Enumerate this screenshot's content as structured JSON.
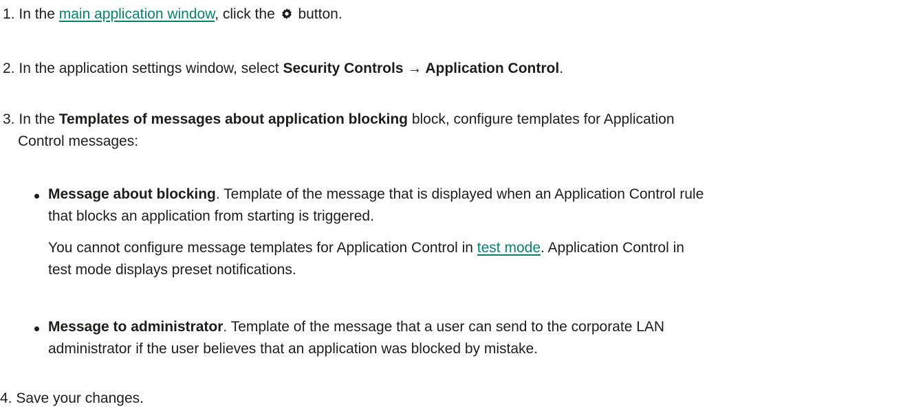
{
  "steps": [
    {
      "number": "1.",
      "text_before": "In the",
      "link": "main application window",
      "text_middle": ", click the",
      "icon": "gear-icon",
      "text_after": "button."
    },
    {
      "number": "2.",
      "text_before": "In the application settings window, select",
      "bold": "Security Controls → Application Control",
      "text_after": "."
    },
    {
      "number": "3.",
      "text_before": "In the",
      "bold": "Templates of messages about application blocking",
      "text_after": "block, configure templates for Application",
      "line2": "Control messages:",
      "bullets": [
        {
          "bold": "Message about blocking",
          "line1": ". Template of the message that is displayed when an Application Control rule",
          "line2": "that blocks an application from starting is triggered.",
          "note_line1_before": "You cannot configure message templates for Application Control in",
          "note_link": "test mode",
          "note_line1_after": ". Application Control in",
          "note_line2": "test mode displays preset notifications."
        },
        {
          "bold": "Message to administrator",
          "line1": ". Template of the message that a user can send to the corporate LAN",
          "line2": "administrator if the user believes that an application was blocked by mistake."
        }
      ]
    },
    {
      "number": "4.",
      "text": "Save your changes."
    }
  ],
  "colors": {
    "text": "#1d1d1b",
    "link": "#0b7f6c"
  }
}
